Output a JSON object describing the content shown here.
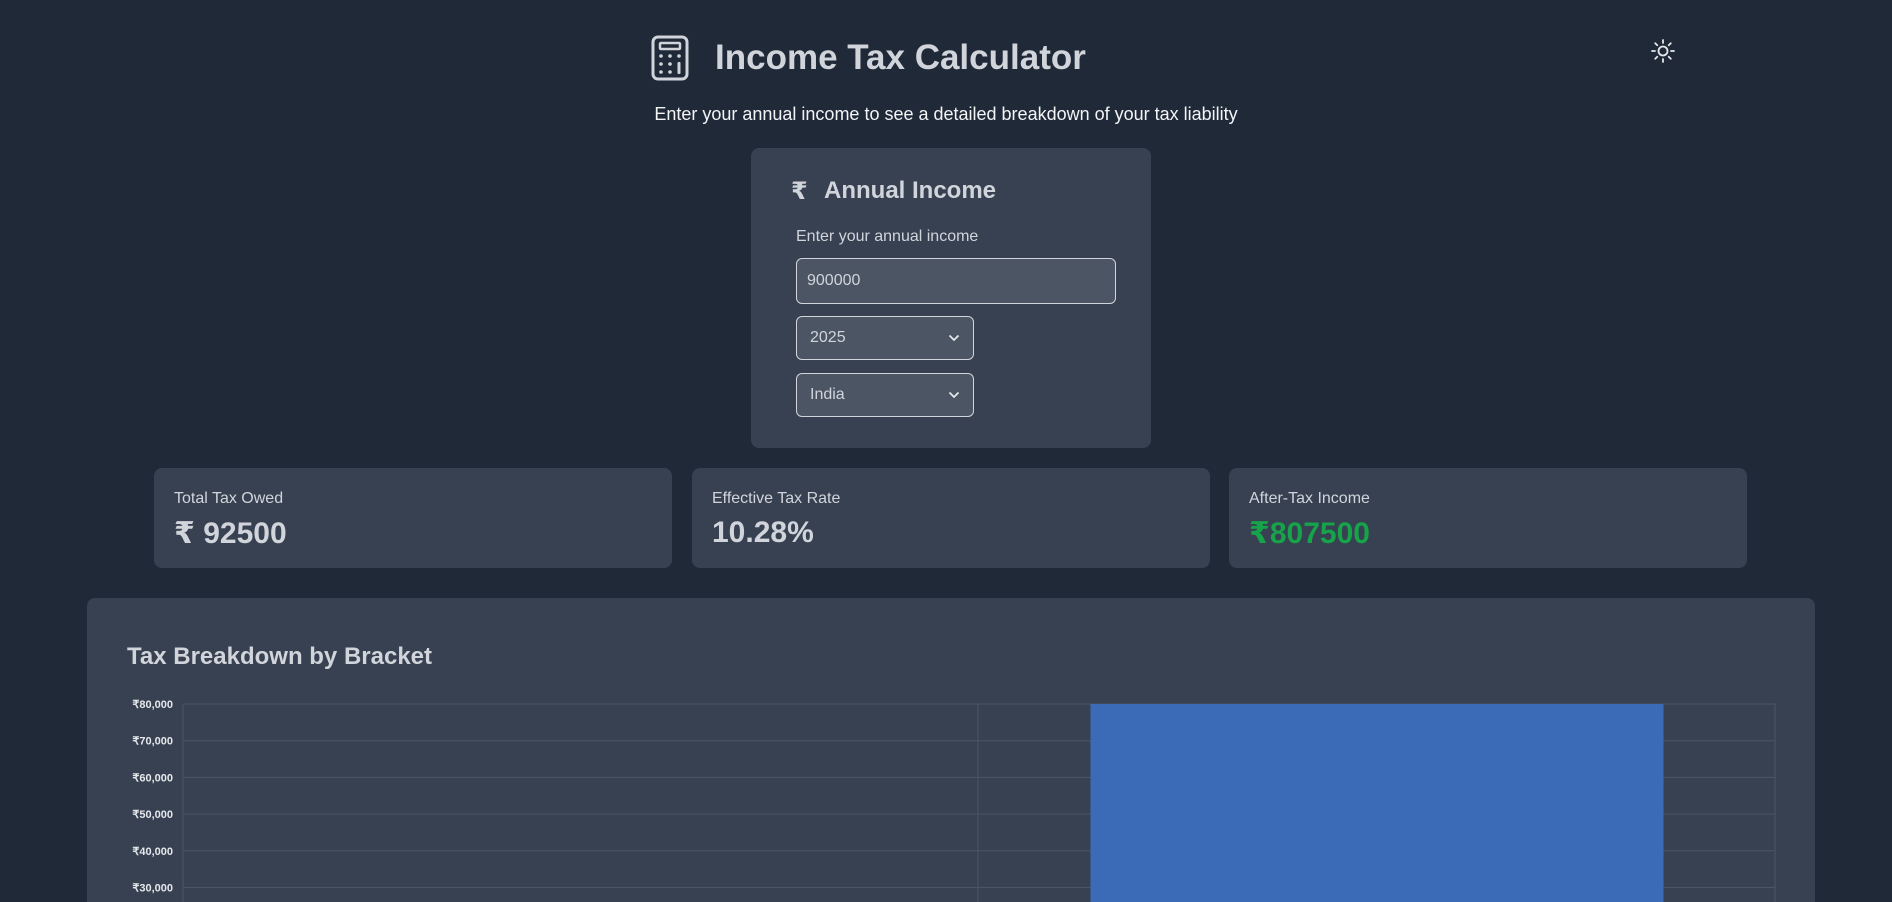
{
  "header": {
    "title": "Income Tax Calculator",
    "subtitle": "Enter your annual income to see a detailed breakdown of your tax liability",
    "icons": {
      "app": "calculator-icon",
      "theme": "sun-icon"
    }
  },
  "income_card": {
    "currency_symbol": "₹",
    "title": "Annual Income",
    "field_label": "Enter your annual income",
    "income_value": "900000",
    "year_selected": "2025",
    "country_selected": "India"
  },
  "summary": {
    "total_tax": {
      "label": "Total Tax Owed",
      "value": "₹ 92500"
    },
    "effective_rate": {
      "label": "Effective Tax Rate",
      "value": "10.28%"
    },
    "after_tax": {
      "label": "After-Tax Income",
      "value": "₹807500"
    }
  },
  "colors": {
    "background": "#1f2937",
    "card": "#374151",
    "accent_green": "#16a34a",
    "bar": "#3b6bb7"
  },
  "chart_data": {
    "type": "bar",
    "title": "Tax Breakdown by Bracket",
    "y_ticks": [
      "₹30,000",
      "₹40,000",
      "₹50,000",
      "₹60,000",
      "₹70,000",
      "₹80,000"
    ],
    "ylim": [
      0,
      80000
    ],
    "grid": true,
    "categories_count": 2,
    "values": [
      0,
      80000
    ]
  }
}
